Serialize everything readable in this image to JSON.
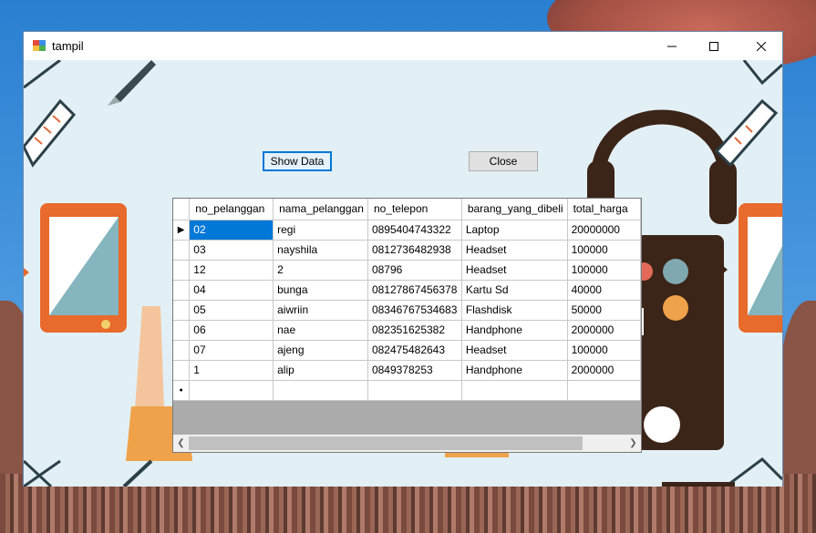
{
  "window": {
    "title": "tampil"
  },
  "buttons": {
    "show_data": "Show Data",
    "close": "Close"
  },
  "grid": {
    "columns": [
      "no_pelanggan",
      "nama_pelanggan",
      "no_telepon",
      "barang_yang_dibeli",
      "total_harga"
    ],
    "rows": [
      [
        "02",
        "regi",
        "0895404743322",
        "Laptop",
        "20000000"
      ],
      [
        "03",
        "nayshila",
        "0812736482938",
        "Headset",
        "100000"
      ],
      [
        "12",
        "2",
        "08796",
        "Headset",
        "100000"
      ],
      [
        "04",
        "bunga",
        "08127867456378",
        "Kartu Sd",
        "40000"
      ],
      [
        "05",
        "aiwriin",
        "083467675346​83",
        "Flashdisk",
        "50000"
      ],
      [
        "06",
        "nae",
        "082351625382",
        "Handphone",
        "2000000"
      ],
      [
        "07",
        "ajeng",
        "082475482643",
        "Headset",
        "100000"
      ],
      [
        "1",
        "alip",
        "0849378253",
        "Handphone",
        "2000000"
      ]
    ],
    "current_row_glyph": "▶",
    "new_row_glyph": "●"
  },
  "colors": {
    "selection": "#0078d7",
    "background": "#e2f0f6"
  }
}
